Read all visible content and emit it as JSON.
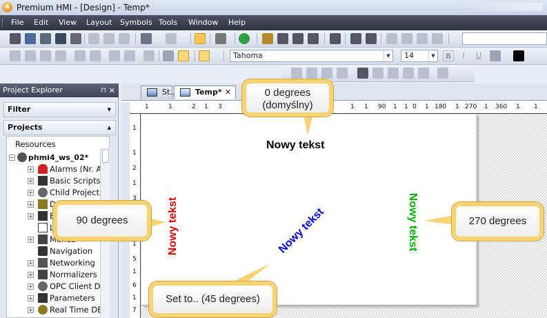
{
  "window": {
    "title": "Premium HMI - [Design] - Temp*",
    "app_icon_glyph": "4"
  },
  "menu": {
    "items": [
      {
        "label": "File"
      },
      {
        "label": "Edit"
      },
      {
        "label": "View"
      },
      {
        "label": "Layout"
      },
      {
        "label": "Symbols"
      },
      {
        "label": "Tools"
      },
      {
        "label": "Window"
      },
      {
        "label": "Help"
      }
    ]
  },
  "format_toolbar": {
    "font_name": "Tahoma",
    "font_size": "14",
    "bold_label": "B",
    "italic_label": "I",
    "underline_label": "U"
  },
  "explorer": {
    "title": "Project Explorer",
    "pin_glyph": "⊓",
    "close_glyph": "✕",
    "filter_label": "Filter",
    "projects_label": "Projects",
    "resources_label": "Resources",
    "root": "phmi4_ws_02*",
    "items": [
      {
        "label": "Alarms (Nr. A"
      },
      {
        "label": "Basic Scripts"
      },
      {
        "label": "Child Projects"
      },
      {
        "label": "Da"
      },
      {
        "label": "Ev"
      },
      {
        "label": "La"
      },
      {
        "label": "Menus"
      },
      {
        "label": "Navigation"
      },
      {
        "label": "Networking"
      },
      {
        "label": "Normalizers"
      },
      {
        "label": "OPC Client Da"
      },
      {
        "label": "Parameters"
      },
      {
        "label": "Real Time DB"
      }
    ]
  },
  "tabs": [
    {
      "label": "St..."
    },
    {
      "label": "Temp*",
      "close_glyph": "✕"
    }
  ],
  "rulers": {
    "h_labels": [
      "1",
      "1",
      "2",
      "1",
      "3",
      "1",
      "1",
      "90",
      "1",
      "1",
      "0",
      "1",
      "180",
      "1",
      "270",
      "1",
      "360",
      "1",
      "1"
    ],
    "v_labels": [
      "1",
      "1",
      "2",
      "1",
      "3",
      "1",
      "4",
      "1",
      "5",
      "1",
      "6",
      "1",
      "7"
    ]
  },
  "canvas": {
    "texts": [
      {
        "text": "Nowy tekst",
        "color": "#000000",
        "rotation_deg": 0
      },
      {
        "text": "Nowy tekst",
        "color": "#e00000",
        "rotation_deg": 90
      },
      {
        "text": "Nowy tekst",
        "color": "#0000e6",
        "rotation_deg": 45
      },
      {
        "text": "Nowy tekst",
        "color": "#00b000",
        "rotation_deg": 270
      }
    ]
  },
  "callouts": {
    "top_line1": "0 degrees",
    "top_line2": "(domyślny)",
    "left": "90 degrees",
    "right": "270 degrees",
    "bottom": "Set to.. (45 degrees)"
  },
  "colors": {
    "accent_border": "#f8d273",
    "menubar_bg": "#3a4150"
  }
}
